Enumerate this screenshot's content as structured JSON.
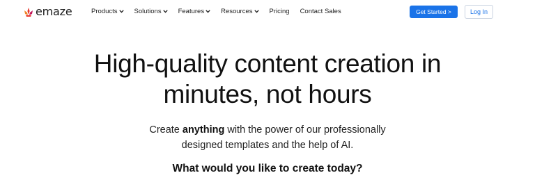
{
  "brand": {
    "name": "emaze",
    "logo_icon": "flame-crown-icon",
    "logo_colors": [
      "#e8372c",
      "#f0852a",
      "#c2185b"
    ]
  },
  "nav": {
    "items": [
      {
        "label": "Products",
        "dropdown": true
      },
      {
        "label": "Solutions",
        "dropdown": true
      },
      {
        "label": "Features",
        "dropdown": true
      },
      {
        "label": "Resources",
        "dropdown": true
      },
      {
        "label": "Pricing",
        "dropdown": false
      },
      {
        "label": "Contact Sales",
        "dropdown": false
      }
    ],
    "cta_label": "Get Started >",
    "login_label": "Log In"
  },
  "hero": {
    "title_line1": "High-quality content creation in",
    "title_line2": "minutes, not hours",
    "subtitle_pre": "Create ",
    "subtitle_bold": "anything",
    "subtitle_post": " with the power of our professionally",
    "subtitle_line2": "designed templates and the help of AI.",
    "question": "What would you like to create today?"
  },
  "colors": {
    "accent": "#1a73e8",
    "text": "#111111"
  }
}
